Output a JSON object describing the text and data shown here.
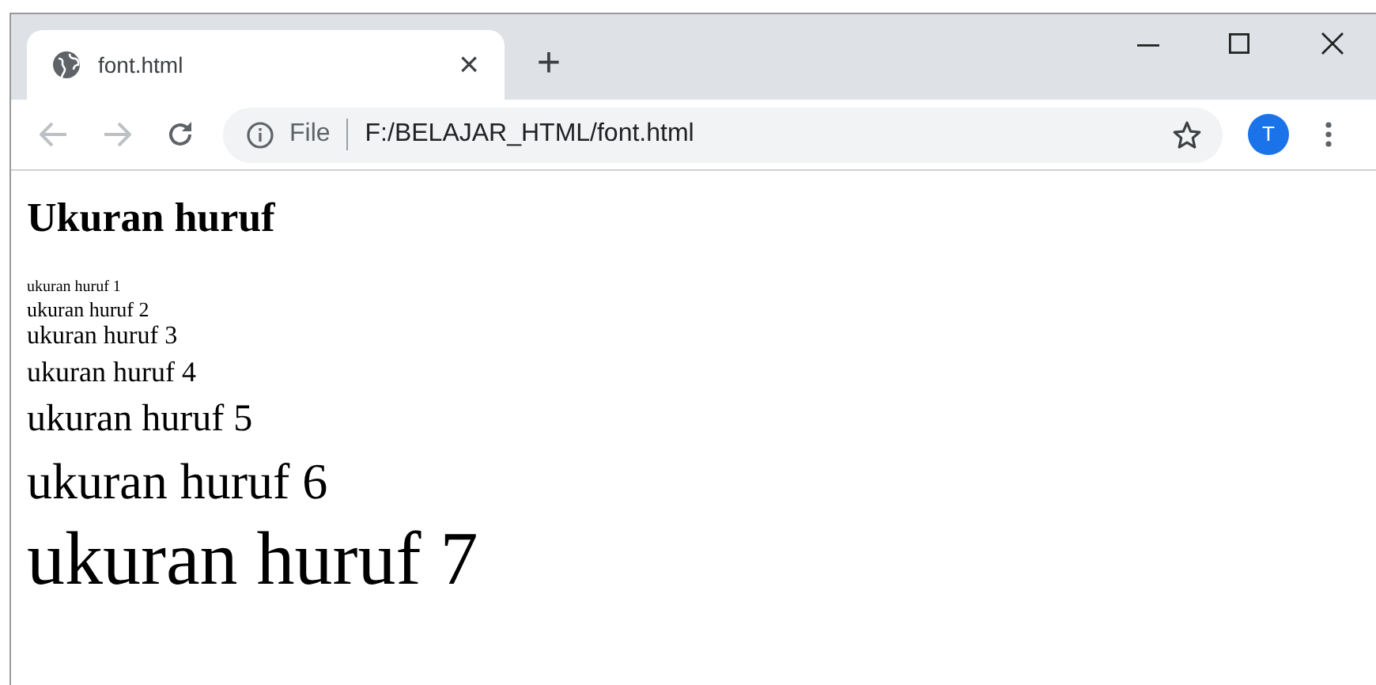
{
  "tabs": [
    {
      "title": "font.html",
      "close": "×",
      "selected": true
    }
  ],
  "new_tab": "+",
  "toolbar": {
    "back_disabled": true,
    "forward_disabled": true,
    "site_label": "File",
    "url": "F:/BELAJAR_HTML/font.html",
    "avatar": "T"
  },
  "page": {
    "heading": "Ukuran huruf",
    "lines": [
      "ukuran huruf 1",
      "ukuran huruf 2",
      "ukuran huruf 3",
      "ukuran huruf 4",
      "ukuran huruf 5",
      "ukuran huruf 6",
      "ukuran huruf 7"
    ]
  }
}
